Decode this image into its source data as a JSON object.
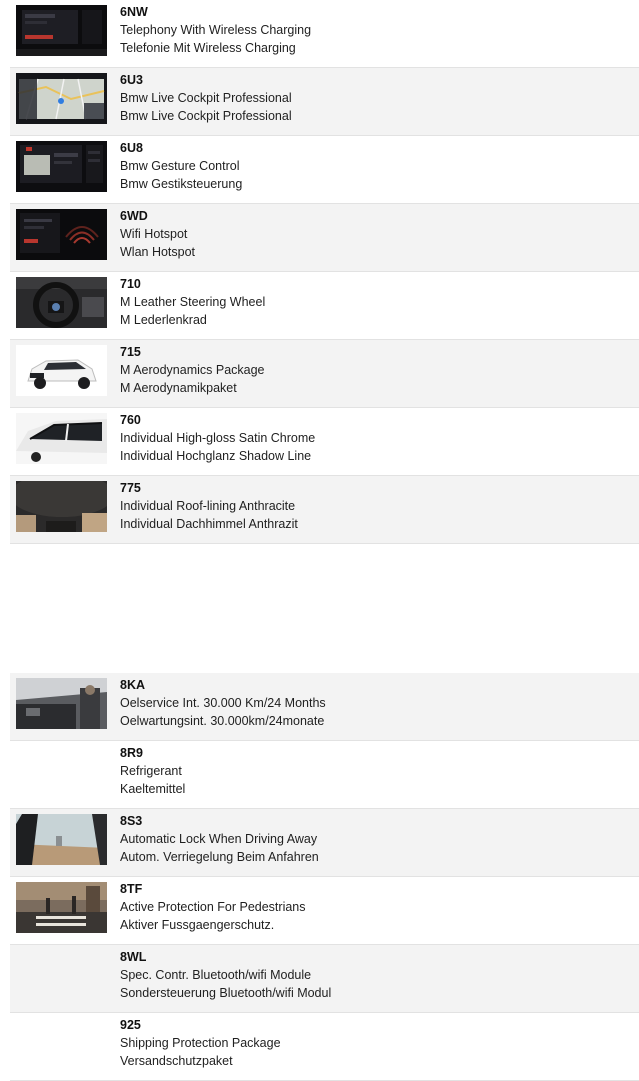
{
  "rows_top": [
    {
      "code": "6NW",
      "name_en": "Telephony With Wireless Charging",
      "name_de": "Telefonie Mit Wireless Charging",
      "image": "dashboard-display-image"
    },
    {
      "code": "6U3",
      "name_en": "Bmw Live Cockpit Professional",
      "name_de": "Bmw Live Cockpit Professional",
      "image": "navigation-map-image"
    },
    {
      "code": "6U8",
      "name_en": "Bmw Gesture Control",
      "name_de": "Bmw Gestiksteuerung",
      "image": "gesture-control-screen-image"
    },
    {
      "code": "6WD",
      "name_en": "Wifi Hotspot",
      "name_de": "Wlan Hotspot",
      "image": "wifi-hotspot-screen-image"
    },
    {
      "code": "710",
      "name_en": "M Leather Steering Wheel",
      "name_de": "M Lederlenkrad",
      "image": "steering-wheel-image"
    },
    {
      "code": "715",
      "name_en": "M Aerodynamics Package",
      "name_de": "M Aerodynamikpaket",
      "image": "white-suv-image"
    },
    {
      "code": "760",
      "name_en": "Individual High-gloss Satin Chrome",
      "name_de": "Individual Hochglanz Shadow Line",
      "image": "window-trim-image"
    },
    {
      "code": "775",
      "name_en": "Individual Roof-lining Anthracite",
      "name_de": "Individual Dachhimmel Anthrazit",
      "image": "roof-lining-image"
    }
  ],
  "rows_bottom": [
    {
      "code": "8KA",
      "name_en": "Oelservice Int. 30.000 Km/24 Months",
      "name_de": "Oelwartungsint. 30.000km/24monate",
      "image": "engine-service-image"
    },
    {
      "code": "8R9",
      "name_en": "Refrigerant",
      "name_de": "Kaeltemittel",
      "image": ""
    },
    {
      "code": "8S3",
      "name_en": "Automatic Lock When Driving Away",
      "name_de": "Autom. Verriegelung Beim Anfahren",
      "image": "door-interior-image"
    },
    {
      "code": "8TF",
      "name_en": "Active Protection For Pedestrians",
      "name_de": "Aktiver Fussgaengerschutz.",
      "image": "street-pedestrians-image"
    },
    {
      "code": "8WL",
      "name_en": "Spec. Contr. Bluetooth/wifi Module",
      "name_de": "Sondersteuerung Bluetooth/wifi Modul",
      "image": ""
    },
    {
      "code": "925",
      "name_en": "Shipping Protection Package",
      "name_de": "Versandschutzpaket",
      "image": ""
    }
  ]
}
